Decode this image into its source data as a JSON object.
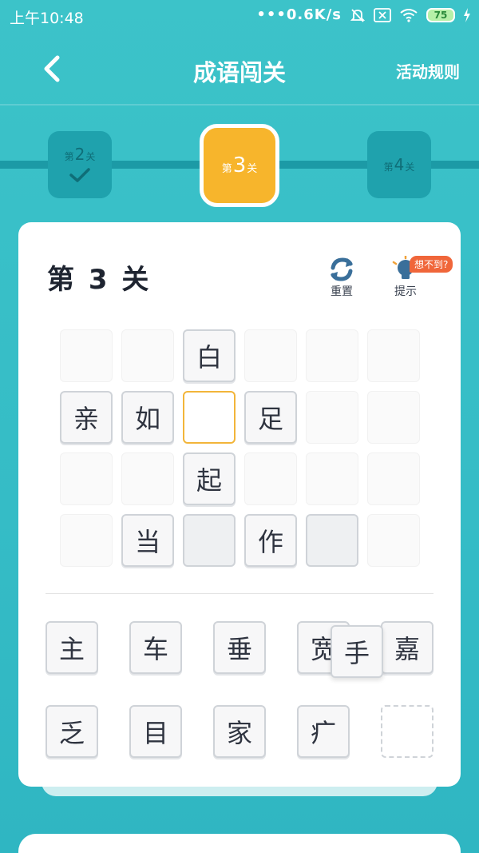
{
  "status_bar": {
    "time": "上午10:48",
    "net_speed": "•••0.6K/s",
    "battery": "75"
  },
  "header": {
    "title": "成语闯关",
    "rules_label": "活动规则"
  },
  "levels": {
    "prefix": "第",
    "suffix": "关",
    "prev_num": "2",
    "current_num": "3",
    "next_num": "4"
  },
  "card": {
    "heading": "第 3 关",
    "reset_label": "重置",
    "hint_label": "提示",
    "hint_badge": "想不到?"
  },
  "grid": {
    "r0c2": "白",
    "r1c0": "亲",
    "r1c1": "如",
    "r1c3": "足",
    "r2c2": "起",
    "r3c1": "当",
    "r3c3": "作"
  },
  "tiles": {
    "t0": "主",
    "t1": "车",
    "t2": "垂",
    "t3": "宽",
    "t4": "嘉",
    "t5": "乏",
    "t6": "目",
    "t7": "家",
    "t8": "疒",
    "dragging": "手"
  },
  "colors": {
    "background": "#3cc3c9",
    "current_level": "#f7b52c",
    "selected_border": "#f2b53a",
    "hint_badge": "#f0663a"
  }
}
